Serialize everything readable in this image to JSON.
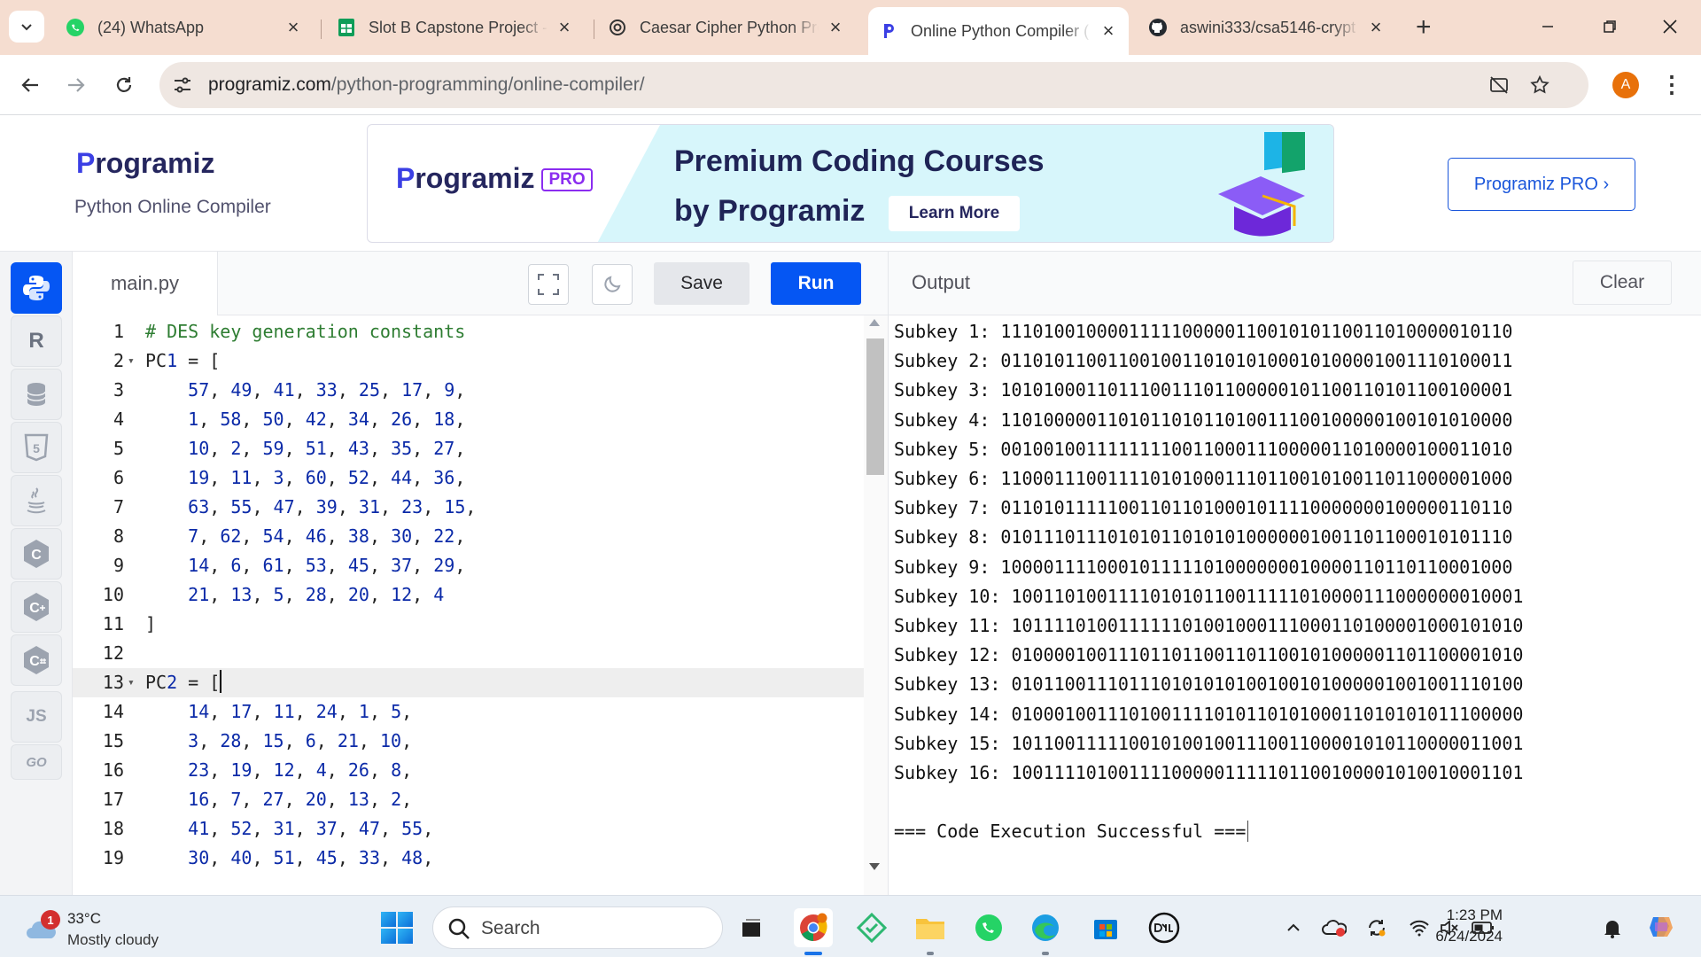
{
  "browser": {
    "tabs": [
      {
        "title": "(24) WhatsApp",
        "icon": "whatsapp-icon"
      },
      {
        "title": "Slot B Capstone Project -",
        "icon": "google-sheets-icon"
      },
      {
        "title": "Caesar Cipher Python Pro",
        "icon": "chatgpt-icon"
      },
      {
        "title": "Online Python Compiler (",
        "icon": "programiz-icon",
        "active": true
      },
      {
        "title": "aswini333/csa5146-crypt",
        "icon": "github-icon"
      }
    ],
    "url_host": "programiz.com",
    "url_path": "/python-programming/online-compiler/",
    "profile_initial": "A"
  },
  "site": {
    "logo_p": "P",
    "logo_rest": "rogramiz",
    "subtitle": "Python Online Compiler",
    "banner": {
      "logo_p": "P",
      "logo_rest": "rogramiz",
      "pro_tag": "PRO",
      "headline_1": "Premium Coding Courses",
      "headline_2": "by Programiz",
      "cta": "Learn More"
    },
    "pro_button": "Programiz PRO ›"
  },
  "languages": [
    {
      "name": "python-icon",
      "label": "",
      "active": true
    },
    {
      "name": "r-icon",
      "label": "R"
    },
    {
      "name": "sql-icon",
      "label": ""
    },
    {
      "name": "html5-icon",
      "label": "5"
    },
    {
      "name": "java-icon",
      "label": ""
    },
    {
      "name": "c-icon",
      "label": "C"
    },
    {
      "name": "cpp-icon",
      "label": "C"
    },
    {
      "name": "csharp-icon",
      "label": "C"
    },
    {
      "name": "javascript-icon",
      "label": "JS"
    },
    {
      "name": "go-icon",
      "label": "GO"
    }
  ],
  "editor": {
    "filename": "main.py",
    "save_label": "Save",
    "run_label": "Run",
    "lines": [
      {
        "n": "1",
        "text": "# DES key generation constants",
        "kind": "comment"
      },
      {
        "n": "2",
        "text": "PC1 = [",
        "fold": true
      },
      {
        "n": "3",
        "text": "    57, 49, 41, 33, 25, 17, 9,"
      },
      {
        "n": "4",
        "text": "    1, 58, 50, 42, 34, 26, 18,"
      },
      {
        "n": "5",
        "text": "    10, 2, 59, 51, 43, 35, 27,"
      },
      {
        "n": "6",
        "text": "    19, 11, 3, 60, 52, 44, 36,"
      },
      {
        "n": "7",
        "text": "    63, 55, 47, 39, 31, 23, 15,"
      },
      {
        "n": "8",
        "text": "    7, 62, 54, 46, 38, 30, 22,"
      },
      {
        "n": "9",
        "text": "    14, 6, 61, 53, 45, 37, 29,"
      },
      {
        "n": "10",
        "text": "    21, 13, 5, 28, 20, 12, 4"
      },
      {
        "n": "11",
        "text": "]"
      },
      {
        "n": "12",
        "text": ""
      },
      {
        "n": "13",
        "text": "PC2 = [",
        "fold": true,
        "current": true
      },
      {
        "n": "14",
        "text": "    14, 17, 11, 24, 1, 5,"
      },
      {
        "n": "15",
        "text": "    3, 28, 15, 6, 21, 10,"
      },
      {
        "n": "16",
        "text": "    23, 19, 12, 4, 26, 8,"
      },
      {
        "n": "17",
        "text": "    16, 7, 27, 20, 13, 2,"
      },
      {
        "n": "18",
        "text": "    41, 52, 31, 37, 47, 55,"
      },
      {
        "n": "19",
        "text": "    30, 40, 51, 45, 33, 48,"
      }
    ]
  },
  "output": {
    "title": "Output",
    "clear_label": "Clear",
    "lines": [
      "Subkey 1: 111010010000111110000011001010110011010000010110",
      "Subkey 2: 011010110011001001101010100010100001001110100011",
      "Subkey 3: 101010001101110011101100000101100110101100100001",
      "Subkey 4: 110100000110101101011010011100100000100101010000",
      "Subkey 5: 001001001111111100110001110000011010000100011010",
      "Subkey 6: 110001110011110101000111011001010011011000001000",
      "Subkey 7: 011010111110011011010001011110000000100000110110",
      "Subkey 8: 010111011101010110101010000001001101100010101110",
      "Subkey 9: 100001111000101111101000000010000110110110001000",
      "Subkey 10: 100110100111101010110011111010000111000000010001",
      "Subkey 11: 101111010011111101001000111000110100001000101010",
      "Subkey 12: 010000100111011011001101100101000001101100001010",
      "Subkey 13: 010110011101110101010100100101000001001001110100",
      "Subkey 14: 010001001110100111101011010100011010101011100000",
      "Subkey 15: 101100111110010100100111001100001010110000011001",
      "Subkey 16: 100111101001111000001111101100100001010010001101",
      "",
      "=== Code Execution Successful ==="
    ]
  },
  "taskbar": {
    "weather_badge": "1",
    "temperature": "33°C",
    "weather_desc": "Mostly cloudy",
    "search_label": "Search",
    "time": "1:23 PM",
    "date": "6/24/2024"
  }
}
